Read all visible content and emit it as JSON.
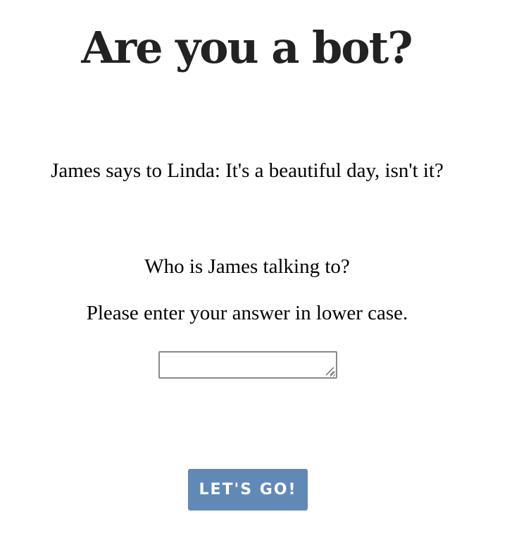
{
  "colors": {
    "background": "#ffffff",
    "title": "#222222",
    "text": "#000000",
    "button_background": "#6089b8",
    "button_text": "#ffffff",
    "input_border": "#8a8a8a"
  },
  "captcha": {
    "title": "Are you a bot?",
    "statement": "James says to Linda: It's a beautiful day, isn't it?",
    "question": "Who is James talking to?",
    "instruction": "Please enter your answer in lower case.",
    "answer_value": "",
    "submit_label": "LET'S GO!"
  },
  "icons": {
    "resize_handle": "resize-grip-icon"
  }
}
